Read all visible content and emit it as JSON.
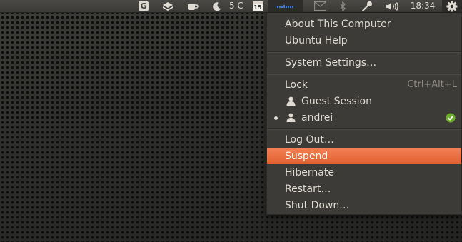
{
  "panel": {
    "indicators": [
      {
        "name": "gmail-indicator",
        "icon": "gmail-g-icon",
        "label": "G"
      },
      {
        "name": "dropbox-indicator",
        "icon": "dropbox-icon"
      },
      {
        "name": "caffeine-indicator",
        "icon": "coffee-cup-icon"
      },
      {
        "name": "weather-indicator",
        "icon": "moon-icon",
        "label": "5 C"
      },
      {
        "name": "calendar-indicator",
        "icon": "calendar-icon",
        "label": "15"
      },
      {
        "name": "network-indicator",
        "icon": "network-graph-icon"
      },
      {
        "name": "messaging-indicator",
        "icon": "envelope-icon"
      },
      {
        "name": "bluetooth-indicator",
        "icon": "bluetooth-icon"
      },
      {
        "name": "microphone-indicator",
        "icon": "microphone-icon"
      },
      {
        "name": "sound-indicator",
        "icon": "speaker-icon"
      },
      {
        "name": "clock",
        "label": "18:34"
      },
      {
        "name": "session-indicator",
        "icon": "gear-icon"
      }
    ]
  },
  "menu": {
    "about": "About This Computer",
    "help": "Ubuntu Help",
    "settings": "System Settings…",
    "lock": "Lock",
    "lock_accel": "Ctrl+Alt+L",
    "guest": "Guest Session",
    "user": "andrei",
    "logout": "Log Out…",
    "suspend": "Suspend",
    "hibernate": "Hibernate",
    "restart": "Restart…",
    "shutdown": "Shut Down…"
  },
  "colors": {
    "highlight": "#f07746",
    "menu_bg": "#3c3b37",
    "panel_bg": "#3f3e3b",
    "check": "#6fae2a"
  }
}
